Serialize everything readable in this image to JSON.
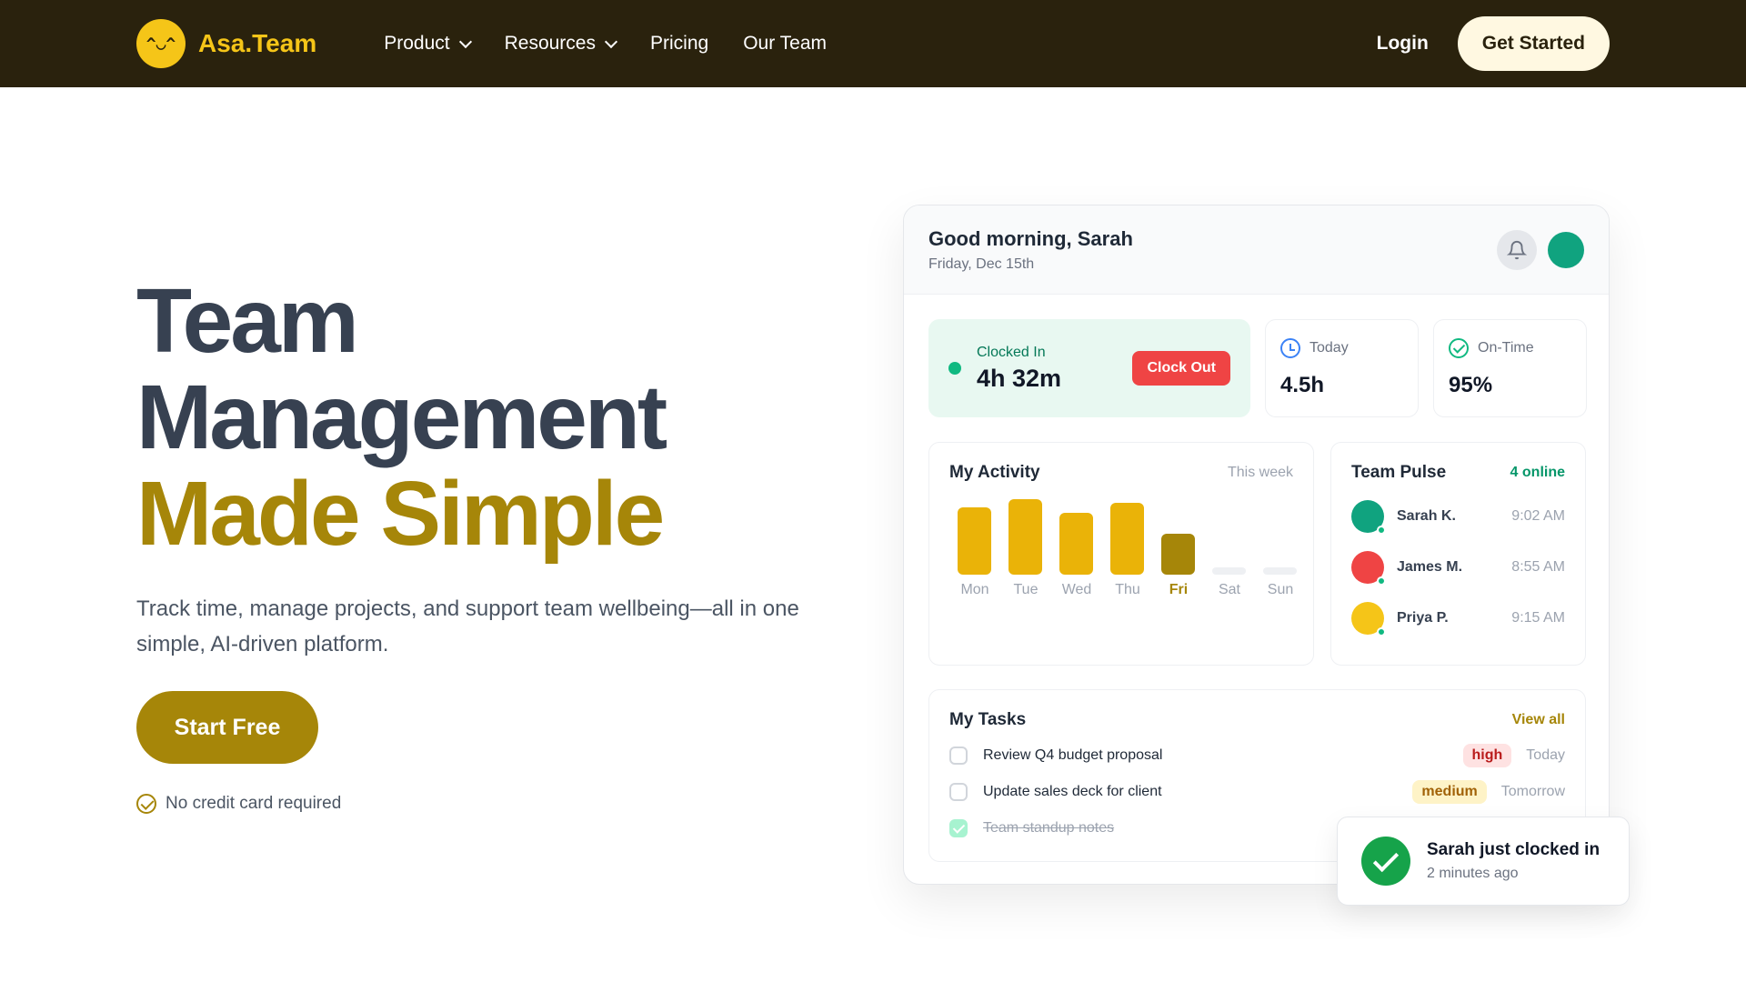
{
  "nav": {
    "brand": "Asa.Team",
    "logo_face": "^◡^",
    "links": [
      {
        "label": "Product",
        "dropdown": true
      },
      {
        "label": "Resources",
        "dropdown": true
      },
      {
        "label": "Pricing",
        "dropdown": false
      },
      {
        "label": "Our Team",
        "dropdown": false
      }
    ],
    "login": "Login",
    "cta": "Get Started"
  },
  "hero": {
    "title_line1": "Team",
    "title_line2": "Management",
    "title_line3": "Made Simple",
    "subtitle": "Track time, manage projects, and support team wellbeing—all in one simple, AI-driven platform.",
    "cta": "Start Free",
    "note": "No credit card required"
  },
  "dashboard": {
    "greeting": "Good morning, Sarah",
    "date": "Friday, Dec 15th",
    "clock": {
      "label": "Clocked In",
      "time": "4h 32m",
      "button": "Clock Out"
    },
    "stats": [
      {
        "label": "Today",
        "value": "4.5h",
        "icon": "clock-icon"
      },
      {
        "label": "On-Time",
        "value": "95%",
        "icon": "check-circle-icon"
      }
    ],
    "activity": {
      "title": "My Activity",
      "range": "This week",
      "chart_data": {
        "type": "bar",
        "categories": [
          "Mon",
          "Tue",
          "Wed",
          "Thu",
          "Fri",
          "Sat",
          "Sun"
        ],
        "values": [
          0.82,
          0.92,
          0.75,
          0.88,
          0.5,
          0.1,
          0.1
        ],
        "highlight": "Fri"
      }
    },
    "pulse": {
      "title": "Team Pulse",
      "online": "4 online",
      "members": [
        {
          "name": "Sarah K.",
          "time": "9:02 AM",
          "color": "#10a37f"
        },
        {
          "name": "James M.",
          "time": "8:55 AM",
          "color": "#ef4444"
        },
        {
          "name": "Priya P.",
          "time": "9:15 AM",
          "color": "#f5c518"
        }
      ]
    },
    "tasks": {
      "title": "My Tasks",
      "view_all": "View all",
      "items": [
        {
          "label": "Review Q4 budget proposal",
          "priority": "high",
          "due": "Today",
          "done": false
        },
        {
          "label": "Update sales deck for client",
          "priority": "medium",
          "due": "Tomorrow",
          "done": false
        },
        {
          "label": "Team standup notes",
          "priority": "",
          "due": "",
          "done": true
        }
      ]
    }
  },
  "toast": {
    "title": "Sarah just clocked in",
    "subtitle": "2 minutes ago"
  },
  "colors": {
    "nav_bg": "#2a220d",
    "brand": "#f5c518",
    "gold": "#a68609",
    "bar": "#eab308"
  }
}
